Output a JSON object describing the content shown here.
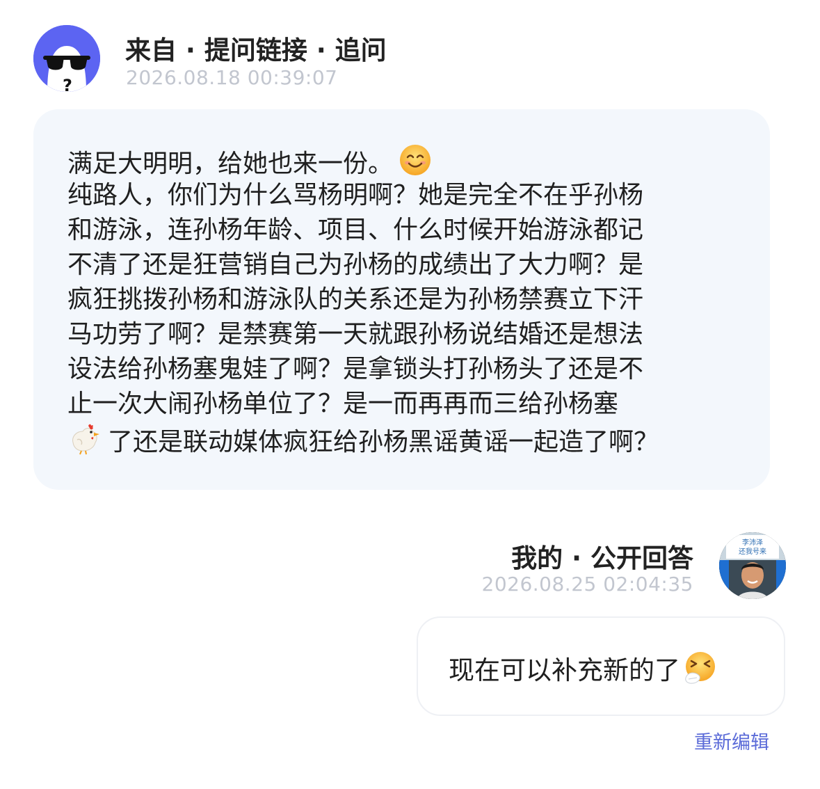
{
  "question": {
    "title": "来自 · 提问链接 · 追问",
    "timestamp": "2026.08.18 00:39:07",
    "avatar_icon": "sunglasses-ghost-avatar",
    "lines": [
      {
        "text": "满足大明明，给她也来一份。",
        "emoji_after": "smiling-face-emoji"
      },
      {
        "text": "纯路人，你们为什么骂杨明啊？她是完全不在乎孙杨"
      },
      {
        "text": "和游泳，连孙杨年龄、项目、什么时候开始游泳都记"
      },
      {
        "text": "不清了还是狂营销自己为孙杨的成绩出了大力啊？是"
      },
      {
        "text": "疯狂挑拨孙杨和游泳队的关系还是为孙杨禁赛立下汗"
      },
      {
        "text": "马功劳了啊？是禁赛第一天就跟孙杨说结婚还是想法"
      },
      {
        "text": "设法给孙杨塞鬼娃了啊？是拿锁头打孙杨头了还是不"
      },
      {
        "text": "止一次大闹孙杨单位了？是一而再再而三给孙杨塞"
      },
      {
        "text": "了还是联动媒体疯狂给孙杨黑谣黄谣一起造了啊？",
        "emoji_before": "chicken-emoji"
      }
    ]
  },
  "answer": {
    "title": "我的 · 公开回答",
    "timestamp": "2026.08.25 02:04:35",
    "avatar_sign_line1": "李沛泽",
    "avatar_sign_line2": "还我号来",
    "text": "现在可以补充新的了",
    "emoji_after": "sneezing-face-emoji"
  },
  "actions": {
    "re_edit_label": "重新编辑"
  },
  "colors": {
    "avatar_bg": "#5c64f2",
    "bubble_bg": "#f3f7fc",
    "timestamp": "#c2c6cf",
    "link": "#5b6bd8"
  }
}
